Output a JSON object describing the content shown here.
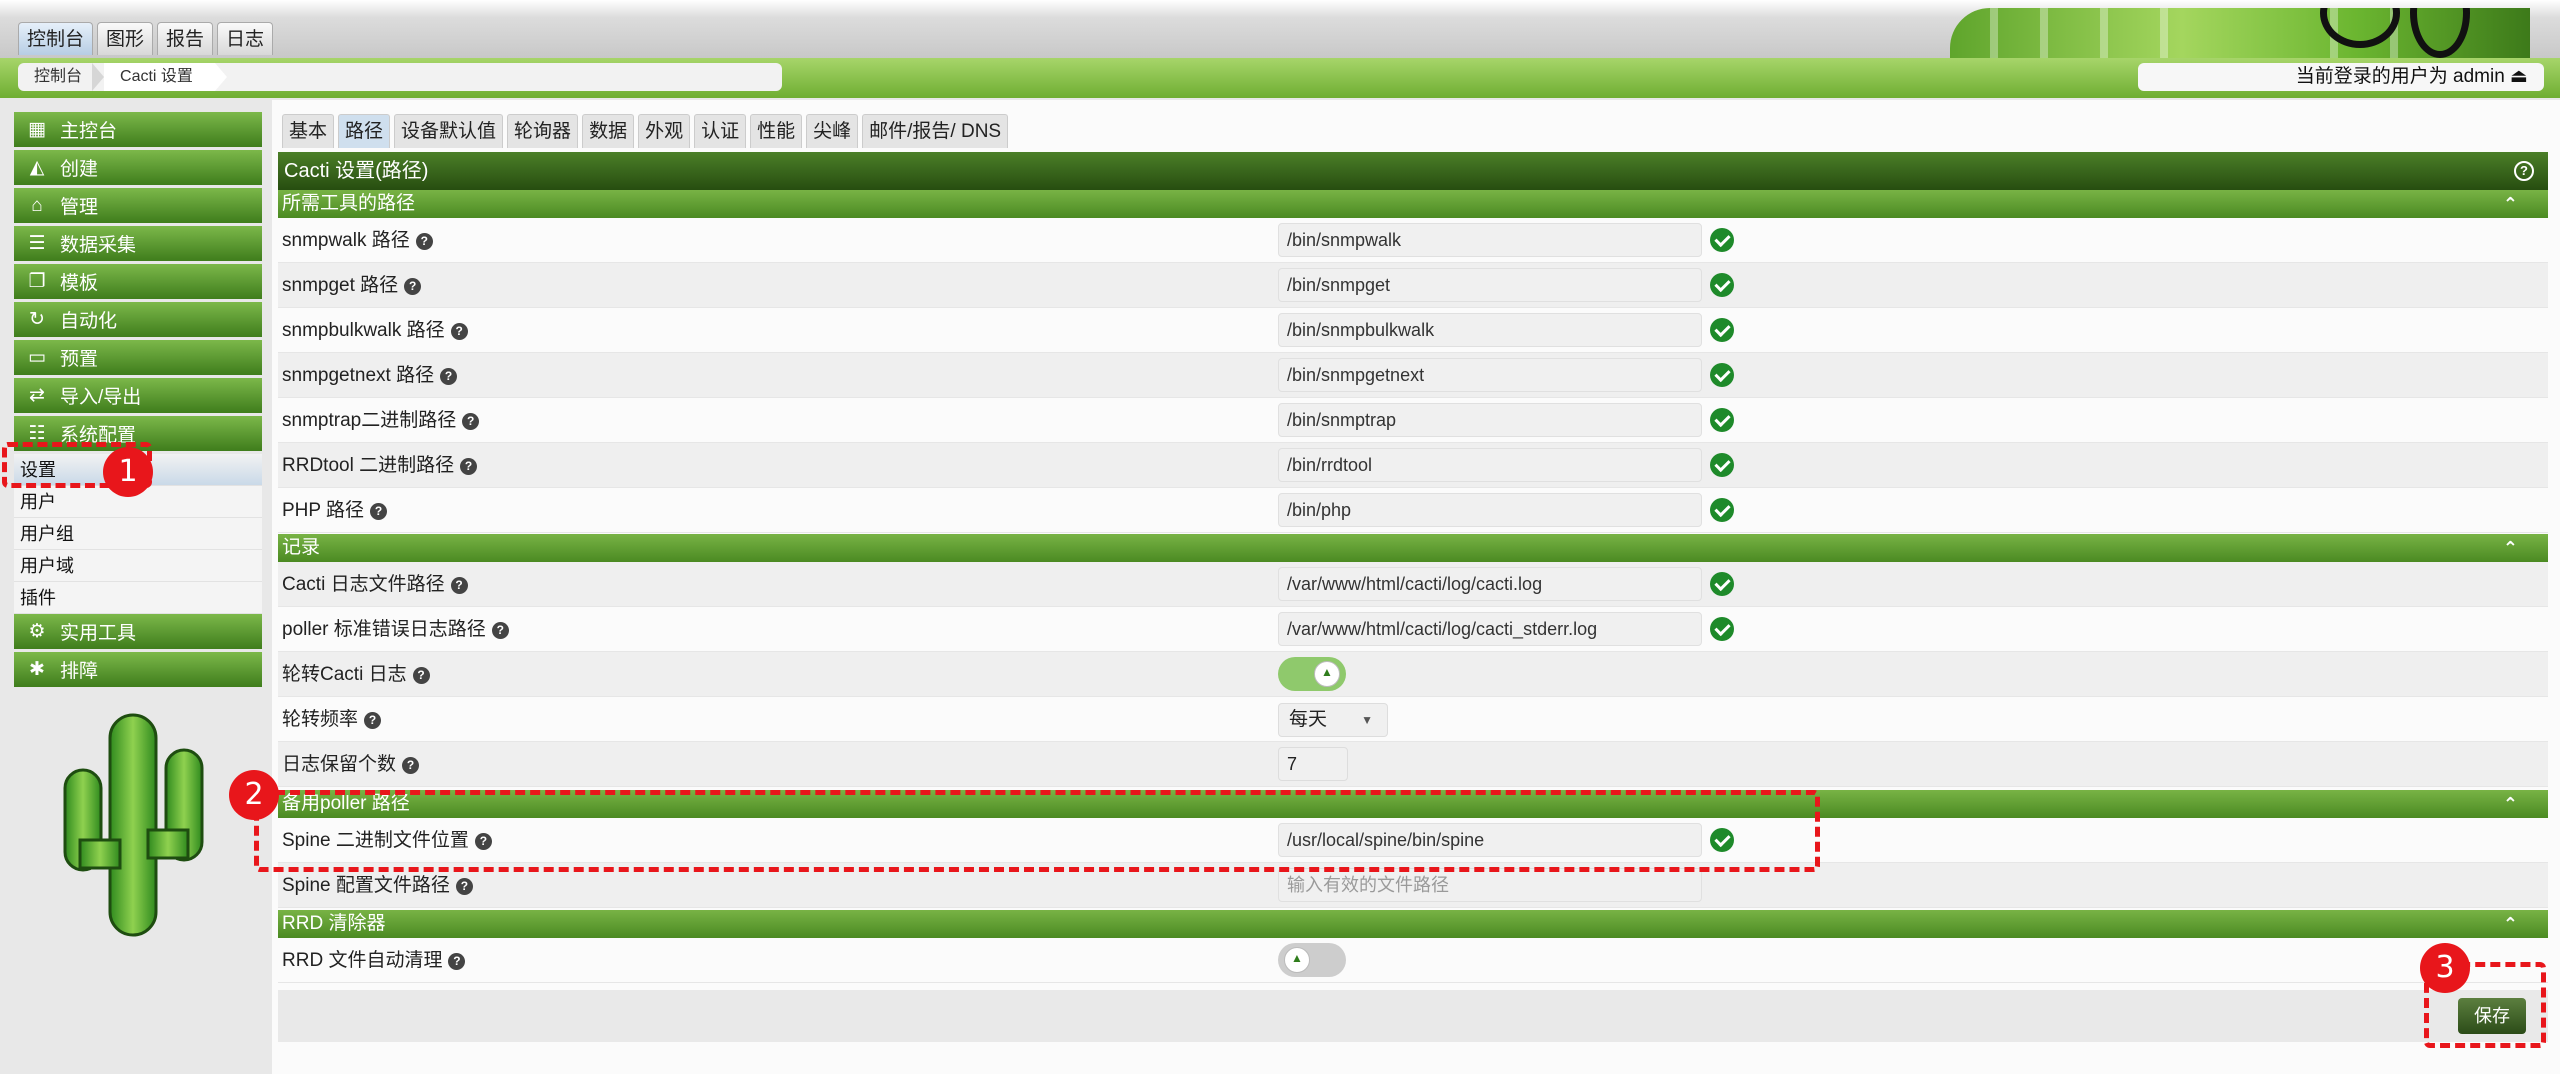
{
  "top_tabs": [
    {
      "label": "控制台"
    },
    {
      "label": "图形"
    },
    {
      "label": "报告"
    },
    {
      "label": "日志"
    }
  ],
  "breadcrumb": [
    {
      "label": "控制台"
    },
    {
      "label": "Cacti 设置"
    }
  ],
  "user_text": "当前登录的用户为 admin ⏏",
  "sidebar": {
    "items_top": [
      {
        "label": "主控台",
        "icon": "map-icon",
        "glyph": "▦"
      },
      {
        "label": "创建",
        "icon": "chart-area-icon",
        "glyph": "◭"
      },
      {
        "label": "管理",
        "icon": "home-icon",
        "glyph": "⌂"
      },
      {
        "label": "数据采集",
        "icon": "database-icon",
        "glyph": "☰"
      },
      {
        "label": "模板",
        "icon": "copy-icon",
        "glyph": "❐"
      },
      {
        "label": "自动化",
        "icon": "sync-icon",
        "glyph": "↻"
      },
      {
        "label": "预置",
        "icon": "folder-icon",
        "glyph": "▭"
      },
      {
        "label": "导入/导出",
        "icon": "exchange-icon",
        "glyph": "⇄"
      },
      {
        "label": "系统配置",
        "icon": "sliders-icon",
        "glyph": "☷"
      }
    ],
    "subitems": [
      {
        "label": "设置"
      },
      {
        "label": "用户"
      },
      {
        "label": "用户组"
      },
      {
        "label": "用户域"
      },
      {
        "label": "插件"
      }
    ],
    "items_bottom": [
      {
        "label": "实用工具",
        "icon": "cogs-icon",
        "glyph": "⚙"
      },
      {
        "label": "排障",
        "icon": "bug-icon",
        "glyph": "✱"
      }
    ]
  },
  "tabs": [
    {
      "label": "基本"
    },
    {
      "label": "路径"
    },
    {
      "label": "设备默认值"
    },
    {
      "label": "轮询器"
    },
    {
      "label": "数据"
    },
    {
      "label": "外观"
    },
    {
      "label": "认证"
    },
    {
      "label": "性能"
    },
    {
      "label": "尖峰"
    },
    {
      "label": "邮件/报告/ DNS"
    }
  ],
  "panel_title": "Cacti 设置(路径)",
  "sections": {
    "required": {
      "title": "所需工具的路径"
    },
    "logging": {
      "title": "记录"
    },
    "alt_poller": {
      "title": "备用poller 路径"
    },
    "rrd_clean": {
      "title": "RRD 清除器"
    }
  },
  "required_rows": [
    {
      "label": "snmpwalk 路径",
      "value": "/bin/snmpwalk"
    },
    {
      "label": "snmpget 路径",
      "value": "/bin/snmpget"
    },
    {
      "label": "snmpbulkwalk 路径",
      "value": "/bin/snmpbulkwalk"
    },
    {
      "label": "snmpgetnext 路径",
      "value": "/bin/snmpgetnext"
    },
    {
      "label": "snmptrap二进制路径",
      "value": "/bin/snmptrap"
    },
    {
      "label": "RRDtool 二进制路径",
      "value": "/bin/rrdtool"
    },
    {
      "label": "PHP 路径",
      "value": "/bin/php"
    }
  ],
  "logging_rows": {
    "log_path": {
      "label": "Cacti 日志文件路径",
      "value": "/var/www/html/cacti/log/cacti.log"
    },
    "stderr_path": {
      "label": "poller 标准错误日志路径",
      "value": "/var/www/html/cacti/log/cacti_stderr.log"
    },
    "rotate": {
      "label": "轮转Cacti 日志"
    },
    "freq": {
      "label": "轮转频率",
      "value": "每天"
    },
    "retain": {
      "label": "日志保留个数",
      "value": "7"
    }
  },
  "alt_poller_rows": {
    "spine_bin": {
      "label": "Spine 二进制文件位置",
      "value": "/usr/local/spine/bin/spine"
    },
    "spine_conf": {
      "label": "Spine 配置文件路径",
      "placeholder": "输入有效的文件路径"
    }
  },
  "rrd_rows": {
    "auto_clean": {
      "label": "RRD 文件自动清理"
    }
  },
  "save_label": "保存",
  "annotations": [
    "1",
    "2",
    "3"
  ],
  "colors": {
    "accent_green": "#4b8a22",
    "annotation_red": "#e8161b",
    "check_green": "#1e8a2a"
  }
}
